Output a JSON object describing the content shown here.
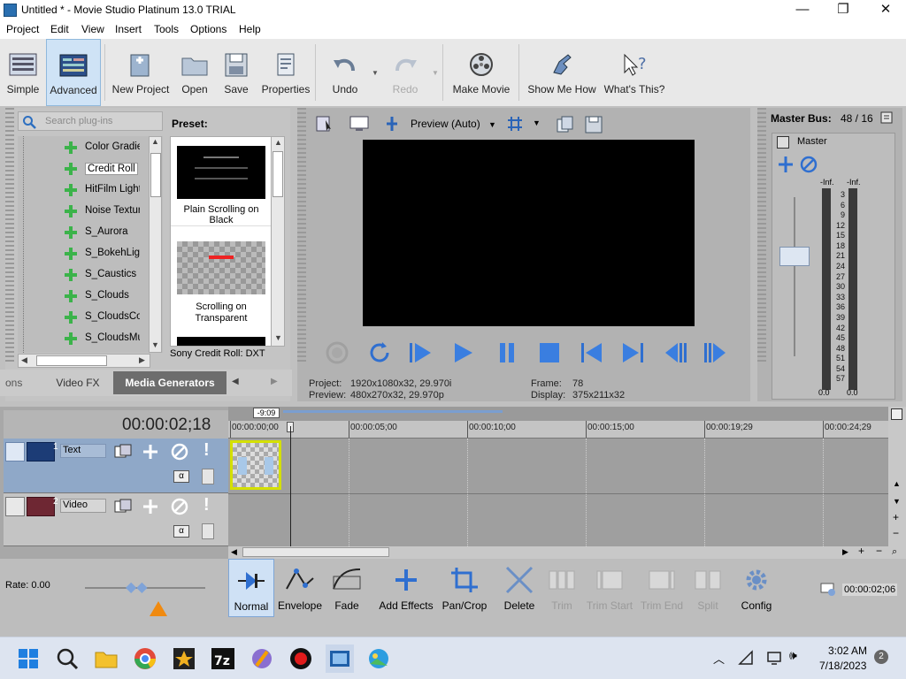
{
  "window": {
    "title": "Untitled * - Movie Studio Platinum 13.0 TRIAL",
    "min": "—",
    "max": "❐",
    "close": "✕"
  },
  "menu": [
    "Project",
    "Edit",
    "View",
    "Insert",
    "Tools",
    "Options",
    "Help"
  ],
  "toolbar": {
    "simple": "Simple",
    "advanced": "Advanced",
    "new_project": "New Project",
    "open": "Open",
    "save": "Save",
    "properties": "Properties",
    "undo": "Undo",
    "redo": "Redo",
    "make_movie": "Make Movie",
    "show_me_how": "Show Me How",
    "whats_this": "What's This?"
  },
  "plugins": {
    "search_placeholder": "Search plug-ins",
    "items": [
      "Color Gradient",
      "Credit Roll",
      "HitFilm Light Flares",
      "Noise Texture",
      "S_Aurora",
      "S_BokehLights",
      "S_Caustics",
      "S_Clouds",
      "S_CloudsColor",
      "S_CloudsMulti"
    ],
    "selected_index": 1,
    "preset_label": "Preset:",
    "presets": [
      "Plain Scrolling on Black",
      "Scrolling on Transparent"
    ],
    "status": "Sony Credit Roll: DXT",
    "tabs": [
      "ons",
      "Video FX",
      "Media Generators"
    ],
    "active_tab": 2
  },
  "preview": {
    "mode": "Preview (Auto)",
    "project_label": "Project:",
    "project_value": "1920x1080x32, 29.970i",
    "preview_label": "Preview:",
    "preview_value": "480x270x32, 29.970p",
    "frame_label": "Frame:",
    "frame_value": "78",
    "display_label": "Display:",
    "display_value": "375x211x32"
  },
  "master": {
    "title": "Master Bus:",
    "value": "48 / 16",
    "label": "Master",
    "inf_left": "-Inf.",
    "inf_right": "-Inf.",
    "scale": [
      "3",
      "6",
      "9",
      "12",
      "15",
      "18",
      "21",
      "24",
      "27",
      "30",
      "33",
      "36",
      "39",
      "42",
      "45",
      "48",
      "51",
      "54",
      "57"
    ],
    "bottom_left": "0.0",
    "bottom_right": "0.0"
  },
  "timeline": {
    "timecode": "00:00:02;18",
    "marker": "-9:09",
    "ruler": [
      "00:00:00;00",
      "00:00:05;00",
      "00:00:10;00",
      "00:00:15;00",
      "00:00:19;29",
      "00:00:24;29"
    ],
    "tracks": [
      {
        "number": "1",
        "name": "Text"
      },
      {
        "number": "2",
        "name": "Video"
      }
    ]
  },
  "bottom": {
    "rate": "Rate: 0.00",
    "normal": "Normal",
    "envelope": "Envelope",
    "fade": "Fade",
    "add_effects": "Add Effects",
    "pan_crop": "Pan/Crop",
    "delete": "Delete",
    "trim": "Trim",
    "trim_start": "Trim Start",
    "trim_end": "Trim End",
    "split": "Split",
    "config": "Config",
    "timecode": "00:00:02;06"
  },
  "taskbar": {
    "time": "3:02 AM",
    "date": "7/18/2023",
    "badge": "2"
  },
  "colors": {
    "accent": "#1f6fd1",
    "panel": "#c0c0c0",
    "track_text": "#8fa8c8",
    "track_video": "#c4c4c4",
    "clip_border": "#d4e000"
  }
}
